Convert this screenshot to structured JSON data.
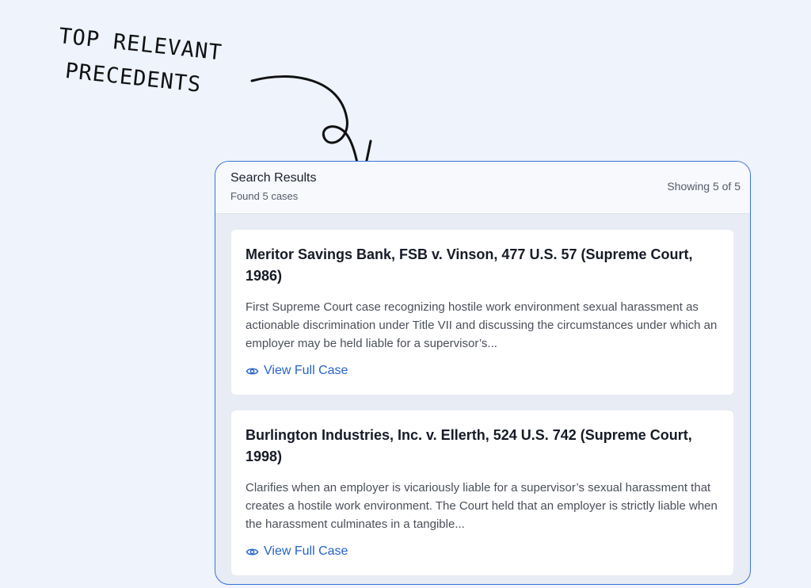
{
  "annotation": {
    "line1": "TOP RELEVANT",
    "line2": "PRECEDENTS"
  },
  "panel": {
    "title": "Search Results",
    "subtitle": "Found 5 cases",
    "count": "Showing 5 of 5"
  },
  "cases": [
    {
      "title": "Meritor Savings Bank, FSB v. Vinson, 477 U.S. 57 (Supreme Court, 1986)",
      "summary": "First Supreme Court case recognizing hostile work environment sexual harassment as actionable discrimination under Title VII and discussing the circumstances under which an employer may be held liable for a supervisor’s...",
      "link_label": "View Full Case",
      "link_icon": "eye-icon"
    },
    {
      "title": "Burlington Industries, Inc. v. Ellerth, 524 U.S. 742 (Supreme Court, 1998)",
      "summary": "Clarifies when an employer is vicariously liable for a supervisor’s sexual harassment that creates a hostile work environment. The Court held that an employer is strictly liable when the harassment culminates in a tangible...",
      "link_label": "View Full Case",
      "link_icon": "eye-icon"
    }
  ],
  "colors": {
    "background": "#eef3fc",
    "panel_border": "#3b73d6",
    "link": "#2563c9"
  }
}
